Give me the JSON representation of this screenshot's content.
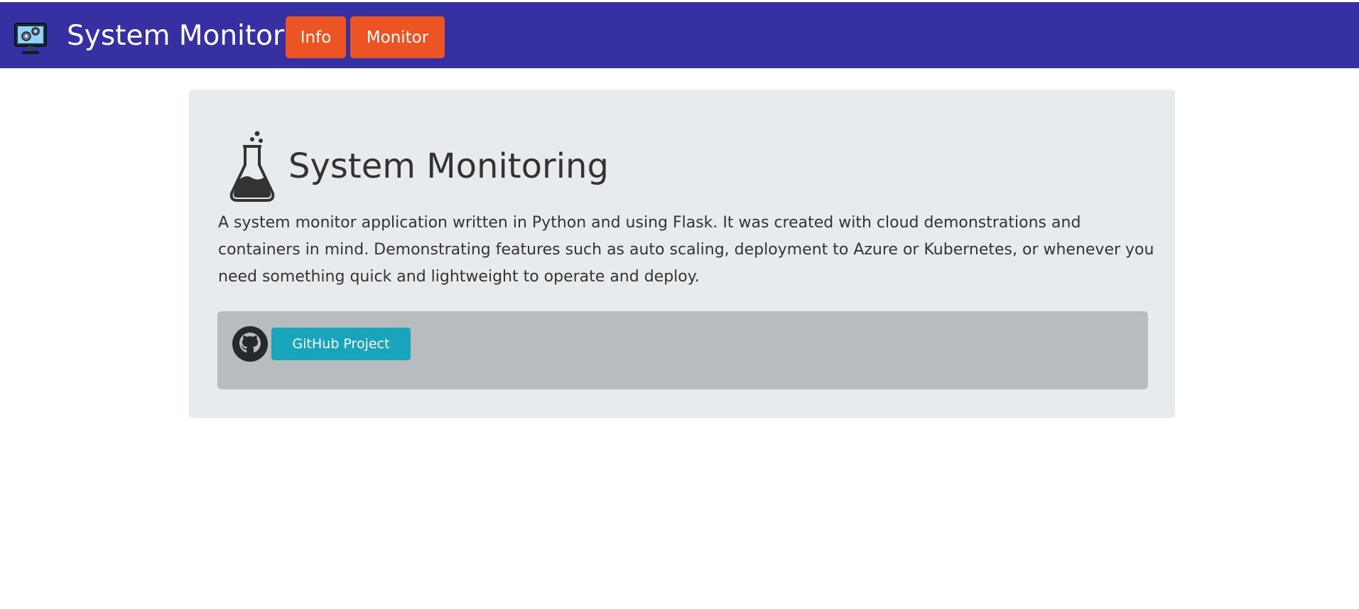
{
  "header": {
    "brand_icon": "monitor-gears-icon",
    "title": "System Monitor",
    "nav": {
      "info_label": "Info",
      "monitor_label": "Monitor"
    }
  },
  "main": {
    "hero_icon": "flask-icon",
    "title": "System Monitoring",
    "description": "A system monitor application written in Python and using Flask. It was created with cloud demonstrations and containers in mind. Demonstrating features such as auto scaling, deployment to Azure or Kubernetes, or whenever you need something quick and lightweight to operate and deploy.",
    "footer": {
      "github_icon": "github-icon",
      "github_button_label": "GitHub Project"
    }
  },
  "colors": {
    "header_bg": "#3730a3",
    "nav_button": "#ec5424",
    "panel_bg": "#e8ebee",
    "footer_bg": "#b8bcbf",
    "github_button": "#18a5bc"
  }
}
